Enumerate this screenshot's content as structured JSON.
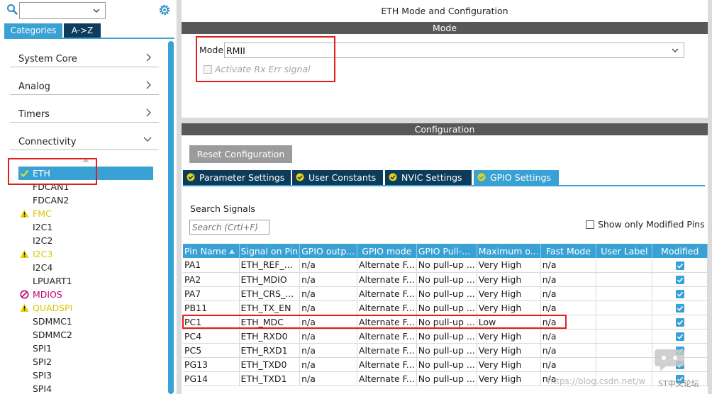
{
  "sidebar": {
    "category_select": "",
    "tabs": [
      "Categories",
      "A->Z"
    ],
    "categories": [
      {
        "label": "System Core"
      },
      {
        "label": "Analog"
      },
      {
        "label": "Timers"
      },
      {
        "label": "Connectivity"
      }
    ],
    "connectivity_items": [
      {
        "label": "ETH",
        "status": "ok",
        "selected": true
      },
      {
        "label": "FDCAN1"
      },
      {
        "label": "FDCAN2"
      },
      {
        "label": "FMC",
        "status": "warning"
      },
      {
        "label": "I2C1"
      },
      {
        "label": "I2C2"
      },
      {
        "label": "I2C3",
        "status": "warning"
      },
      {
        "label": "I2C4"
      },
      {
        "label": "LPUART1"
      },
      {
        "label": "MDIOS",
        "status": "disabled"
      },
      {
        "label": "QUADSPI",
        "status": "warning"
      },
      {
        "label": "SDMMC1"
      },
      {
        "label": "SDMMC2"
      },
      {
        "label": "SPI1"
      },
      {
        "label": "SPI2"
      },
      {
        "label": "SPI3"
      },
      {
        "label": "SPI4"
      }
    ]
  },
  "mode_panel": {
    "title": "ETH Mode and Configuration",
    "section": "Mode",
    "mode_label": "Mode",
    "mode_value": "RMII",
    "rx_err_label": "Activate Rx Err signal",
    "rx_err_checked": false
  },
  "config_panel": {
    "section": "Configuration",
    "reset_button": "Reset Configuration",
    "tabs": [
      {
        "label": "Parameter Settings"
      },
      {
        "label": "User Constants"
      },
      {
        "label": "NVIC Settings"
      },
      {
        "label": "GPIO Settings",
        "active": true
      }
    ],
    "search_label": "Search Signals",
    "search_placeholder": "Search (Crtl+F)",
    "show_modified_label": "Show only Modified Pins",
    "show_modified_checked": false,
    "table": {
      "headers": [
        "Pin Name",
        "Signal on Pin",
        "GPIO outp...",
        "GPIO mode",
        "GPIO Pull-...",
        "Maximum o...",
        "Fast Mode",
        "User Label",
        "Modified"
      ],
      "rows": [
        [
          "PA1",
          "ETH_REF_...",
          "n/a",
          "Alternate F...",
          "No pull-up ...",
          "Very High",
          "n/a",
          "",
          true
        ],
        [
          "PA2",
          "ETH_MDIO",
          "n/a",
          "Alternate F...",
          "No pull-up ...",
          "Very High",
          "n/a",
          "",
          true
        ],
        [
          "PA7",
          "ETH_CRS_...",
          "n/a",
          "Alternate F...",
          "No pull-up ...",
          "Very High",
          "n/a",
          "",
          true
        ],
        [
          "PB11",
          "ETH_TX_EN",
          "n/a",
          "Alternate F...",
          "No pull-up ...",
          "Very High",
          "n/a",
          "",
          true
        ],
        [
          "PC1",
          "ETH_MDC",
          "n/a",
          "Alternate F...",
          "No pull-up ...",
          "Low",
          "n/a",
          "",
          true
        ],
        [
          "PC4",
          "ETH_RXD0",
          "n/a",
          "Alternate F...",
          "No pull-up ...",
          "Very High",
          "n/a",
          "",
          true
        ],
        [
          "PC5",
          "ETH_RXD1",
          "n/a",
          "Alternate F...",
          "No pull-up ...",
          "Very High",
          "n/a",
          "",
          true
        ],
        [
          "PG13",
          "ETH_TXD0",
          "n/a",
          "Alternate F...",
          "No pull-up ...",
          "Very High",
          "n/a",
          "",
          true
        ],
        [
          "PG14",
          "ETH_TXD1",
          "n/a",
          "Alternate F...",
          "No pull-up ...",
          "Very High",
          "n/a",
          "",
          true
        ]
      ]
    }
  },
  "watermark": {
    "url": "https://blog.csdn.net/w",
    "forum": "ST中文论坛"
  },
  "colors": {
    "accent": "#39a1d4",
    "dark_tab": "#0d3b5a",
    "section_bar": "#585858",
    "annotation_red": "#e21f1f",
    "warning": "#d8c600",
    "disabled": "#c4007d"
  }
}
